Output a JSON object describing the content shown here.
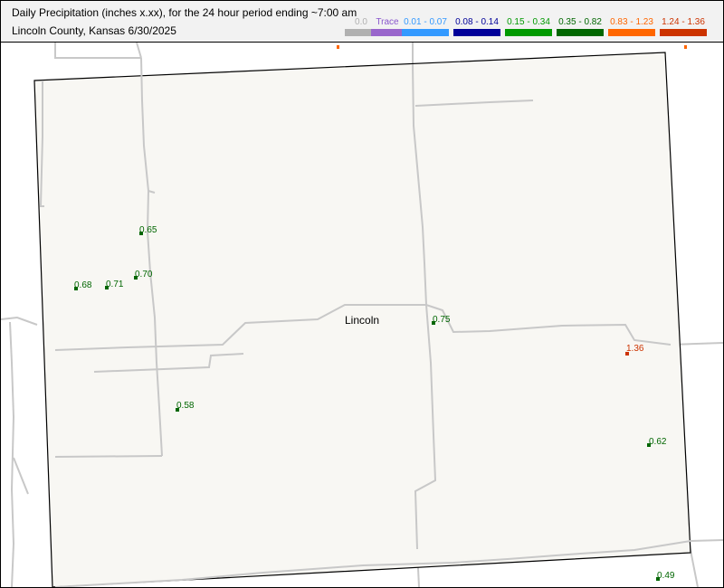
{
  "header": {
    "title_line1": "Daily Precipitation (inches  x.xx),  for the 24 hour period ending ~7:00 am",
    "title_line2": "Lincoln County, Kansas  6/30/2025"
  },
  "legend": [
    {
      "label": "0.0",
      "color": "#b0b0b0",
      "text_color": "#b0b0b0"
    },
    {
      "label": "Trace",
      "color": "#9966cc",
      "text_color": "#8855cc"
    },
    {
      "label": "0.01 - 0.07",
      "color": "#3399ff",
      "text_color": "#3399ff"
    },
    {
      "label": "0.08 - 0.14",
      "color": "#000099",
      "text_color": "#000099"
    },
    {
      "label": "0.15 - 0.34",
      "color": "#009900",
      "text_color": "#009900"
    },
    {
      "label": "0.35 - 0.82",
      "color": "#006600",
      "text_color": "#006600"
    },
    {
      "label": "0.83 - 1.23",
      "color": "#ff6600",
      "text_color": "#ff6600"
    },
    {
      "label": "1.24 - 1.36",
      "color": "#cc3300",
      "text_color": "#cc3300"
    }
  ],
  "map": {
    "town": "Lincoln",
    "stations": [
      {
        "value": "0.65",
        "color": "#006600"
      },
      {
        "value": "0.70",
        "color": "#006600"
      },
      {
        "value": "0.68",
        "color": "#006600"
      },
      {
        "value": "0.71",
        "color": "#006600"
      },
      {
        "value": "0.75",
        "color": "#006600"
      },
      {
        "value": "1.36",
        "color": "#cc3300"
      },
      {
        "value": "0.58",
        "color": "#006600"
      },
      {
        "value": "0.62",
        "color": "#006600"
      },
      {
        "value": "0.49",
        "color": "#006600"
      }
    ]
  }
}
